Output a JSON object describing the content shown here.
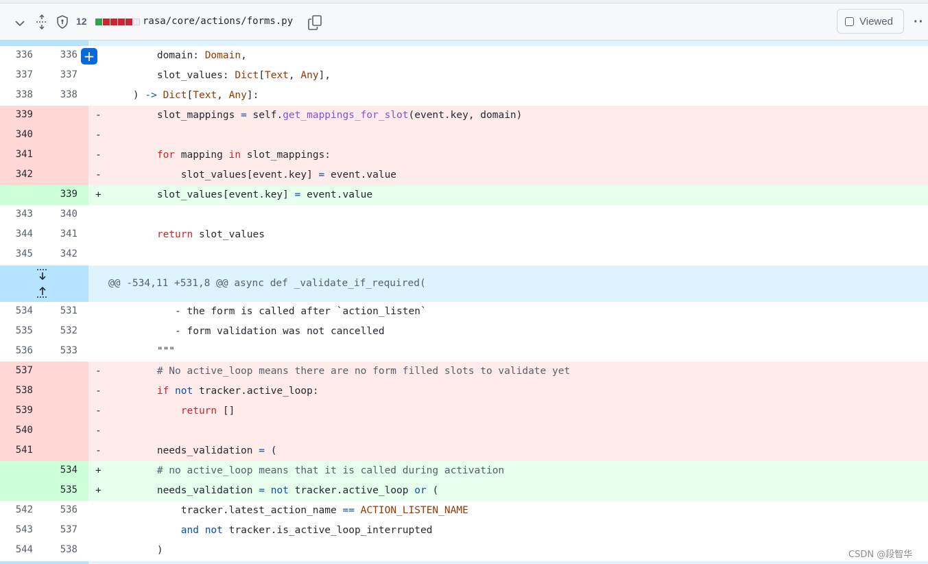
{
  "header": {
    "changed_count": "12",
    "file_path": "rasa/core/actions/forms.py",
    "viewed_label": "Viewed",
    "diffstat_colors": [
      "#2da44e",
      "#cf222e",
      "#cf222e",
      "#cf222e",
      "#cf222e",
      "#eaeef2"
    ]
  },
  "hunk_header": "@@ -534,11 +531,8 @@ async def _validate_if_required(",
  "watermark": "CSDN @段智华",
  "colors": {
    "deletion_bg": "#ffebe9",
    "addition_bg": "#e6ffec",
    "hunk_bg": "#ddf4ff",
    "accent": "#0969da"
  },
  "block1": [
    {
      "type": "ctx",
      "old": "336",
      "new": "336",
      "tokens": [
        [
          "",
          "        domain: "
        ],
        [
          "ty",
          "Domain"
        ],
        [
          "",
          ","
        ]
      ]
    },
    {
      "type": "ctx",
      "old": "337",
      "new": "337",
      "tokens": [
        [
          "",
          "        slot_values: "
        ],
        [
          "ty",
          "Dict"
        ],
        [
          "",
          "["
        ],
        [
          "ty",
          "Text"
        ],
        [
          "",
          ", "
        ],
        [
          "ty",
          "Any"
        ],
        [
          "",
          "],"
        ]
      ]
    },
    {
      "type": "ctx",
      "old": "338",
      "new": "338",
      "tokens": [
        [
          "",
          "    ) "
        ],
        [
          "nm",
          "->"
        ],
        [
          "",
          ""
        ],
        [
          "ty",
          " Dict"
        ],
        [
          "",
          "["
        ],
        [
          "ty",
          "Text"
        ],
        [
          "",
          ", "
        ],
        [
          "ty",
          "Any"
        ],
        [
          "",
          "]:"
        ]
      ]
    },
    {
      "type": "del",
      "old": "339",
      "new": "",
      "tokens": [
        [
          "",
          "        slot_mappings "
        ],
        [
          "nm",
          "="
        ],
        [
          "",
          " self."
        ],
        [
          "fn",
          "get_mappings_for_slot"
        ],
        [
          "",
          "(event.key, domain)"
        ]
      ]
    },
    {
      "type": "del",
      "old": "340",
      "new": "",
      "tokens": []
    },
    {
      "type": "del",
      "old": "341",
      "new": "",
      "tokens": [
        [
          "key",
          "        for"
        ],
        [
          "",
          " mapping "
        ],
        [
          "key",
          "in"
        ],
        [
          "",
          " slot_mappings:"
        ]
      ]
    },
    {
      "type": "del",
      "old": "342",
      "new": "",
      "tokens": [
        [
          "",
          "            slot_values[event.key] "
        ],
        [
          "nm",
          "="
        ],
        [
          "",
          " event.value"
        ]
      ]
    },
    {
      "type": "add",
      "old": "",
      "new": "339",
      "tokens": [
        [
          "",
          "        slot_values[event.key] "
        ],
        [
          "nm",
          "="
        ],
        [
          "",
          " event.value"
        ]
      ]
    },
    {
      "type": "ctx",
      "old": "343",
      "new": "340",
      "tokens": []
    },
    {
      "type": "ctx",
      "old": "344",
      "new": "341",
      "tokens": [
        [
          "key",
          "        return"
        ],
        [
          "",
          " slot_values"
        ]
      ]
    },
    {
      "type": "ctx",
      "old": "345",
      "new": "342",
      "tokens": []
    }
  ],
  "block2": [
    {
      "type": "ctx",
      "old": "534",
      "new": "531",
      "tokens": [
        [
          "",
          "           - "
        ],
        [
          "key",
          ""
        ],
        [
          "",
          "the form is called after `action_listen`"
        ]
      ]
    },
    {
      "type": "ctx",
      "old": "535",
      "new": "532",
      "tokens": [
        [
          "",
          "           - form validation was not cancelled"
        ]
      ]
    },
    {
      "type": "ctx",
      "old": "536",
      "new": "533",
      "tokens": [
        [
          "",
          "        \"\"\""
        ]
      ]
    },
    {
      "type": "del",
      "old": "537",
      "new": "",
      "tokens": [
        [
          "cm",
          "        # No active_loop means there are no form filled slots to validate yet"
        ]
      ]
    },
    {
      "type": "del",
      "old": "538",
      "new": "",
      "tokens": [
        [
          "key",
          "        if"
        ],
        [
          "",
          " "
        ],
        [
          "nm",
          "not"
        ],
        [
          "",
          " tracker.active_loop:"
        ]
      ]
    },
    {
      "type": "del",
      "old": "539",
      "new": "",
      "tokens": [
        [
          "key",
          "            return"
        ],
        [
          "",
          " []"
        ]
      ]
    },
    {
      "type": "del",
      "old": "540",
      "new": "",
      "tokens": []
    },
    {
      "type": "del",
      "old": "541",
      "new": "",
      "tokens": [
        [
          "",
          "        needs_validation "
        ],
        [
          "nm",
          "="
        ],
        [
          "",
          " ("
        ]
      ]
    },
    {
      "type": "add",
      "old": "",
      "new": "534",
      "tokens": [
        [
          "cm",
          "        # no active_loop means that it is called during activation"
        ]
      ]
    },
    {
      "type": "add",
      "old": "",
      "new": "535",
      "tokens": [
        [
          "",
          "        needs_validation "
        ],
        [
          "nm",
          "="
        ],
        [
          "",
          " "
        ],
        [
          "nm",
          "not"
        ],
        [
          "",
          " tracker.active_loop "
        ],
        [
          "nm",
          "or"
        ],
        [
          "",
          " ("
        ]
      ]
    },
    {
      "type": "ctx",
      "old": "542",
      "new": "536",
      "tokens": [
        [
          "",
          "            tracker.latest_action_name "
        ],
        [
          "nm",
          "=="
        ],
        [
          "",
          " "
        ],
        [
          "ty",
          "ACTION_LISTEN_NAME"
        ]
      ]
    },
    {
      "type": "ctx",
      "old": "543",
      "new": "537",
      "tokens": [
        [
          "",
          "            "
        ],
        [
          "nm",
          "and"
        ],
        [
          "",
          " "
        ],
        [
          "nm",
          "not"
        ],
        [
          "",
          " tracker.is_active_loop_interrupted"
        ]
      ]
    },
    {
      "type": "ctx",
      "old": "544",
      "new": "538",
      "tokens": [
        [
          "",
          "        )"
        ]
      ]
    }
  ]
}
